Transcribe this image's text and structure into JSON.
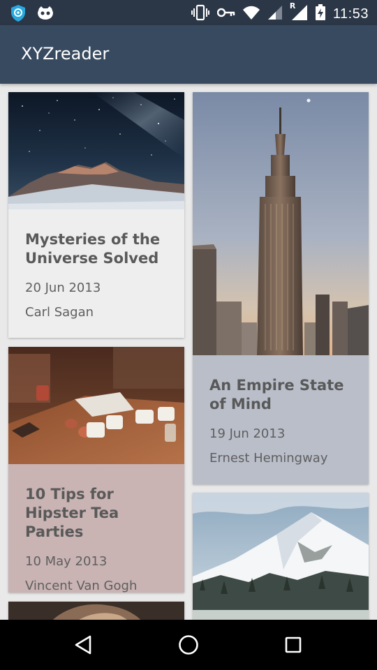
{
  "status_bar": {
    "time": "11:53",
    "icons": [
      "shield-icon",
      "game-controller-icon",
      "vibrate-icon",
      "key-icon",
      "wifi-icon",
      "signal-icon",
      "signal-roaming-icon",
      "battery-charging-icon"
    ],
    "roaming_label": "R"
  },
  "app_bar": {
    "title": "XYZreader"
  },
  "articles": [
    {
      "title": "Mysteries of the Universe Solved",
      "date": "20 Jun 2013",
      "author": "Carl Sagan",
      "image": "night-sky-mountain-photo",
      "card_color": "#eeeeee"
    },
    {
      "title": "An Empire State of Mind",
      "date": "19 Jun 2013",
      "author": "Ernest Hemingway",
      "image": "empire-state-building-photo",
      "card_color": "#b9bec9"
    },
    {
      "title": "10 Tips for Hipster Tea Parties",
      "date": "10 May 2013",
      "author": "Vincent Van Gogh",
      "image": "tea-cups-photo",
      "card_color": "#c9b3b3"
    },
    {
      "image": "snowy-mountain-photo",
      "card_color": "#c8d0cc"
    },
    {
      "image": "animal-photo",
      "card_color": "#dddddd"
    }
  ],
  "nav_bar": {
    "icons": [
      "back-triangle-icon",
      "home-circle-icon",
      "recents-square-icon"
    ]
  }
}
